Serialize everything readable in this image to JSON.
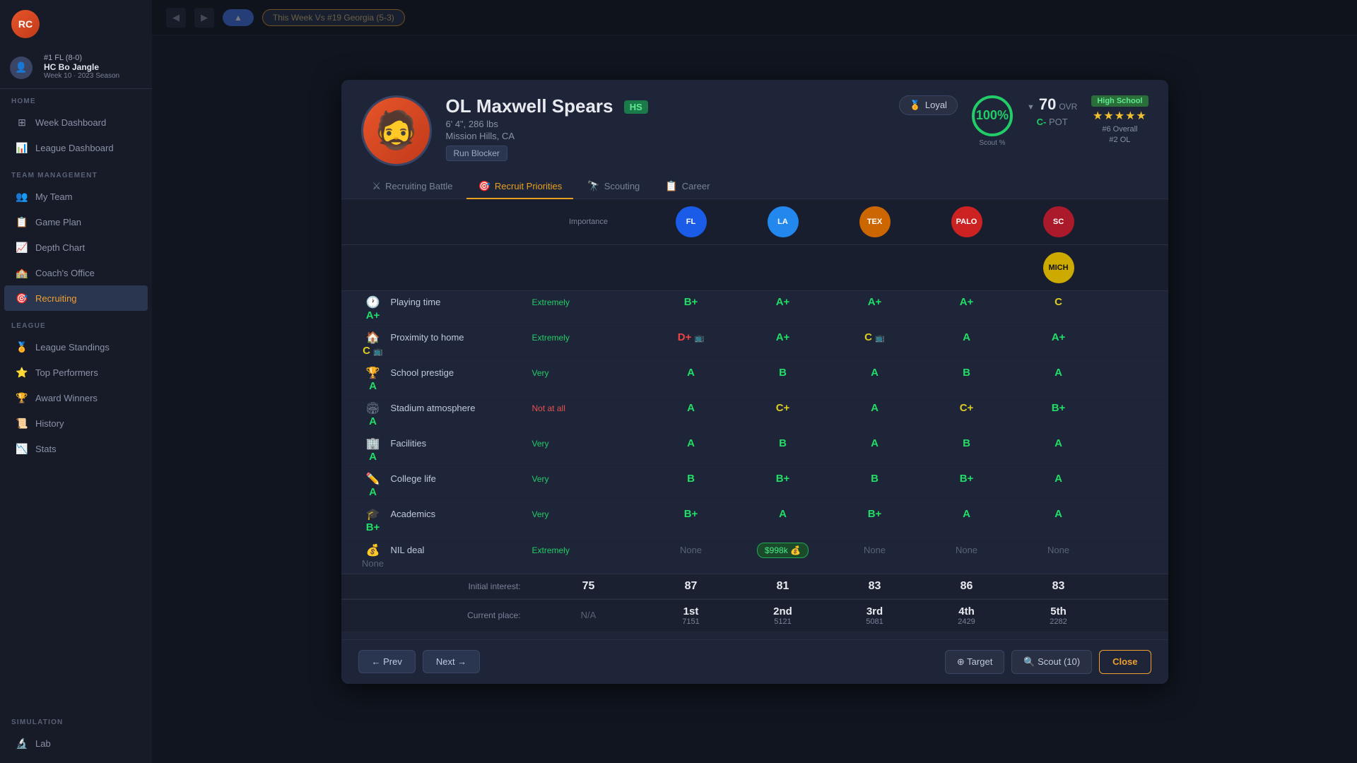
{
  "app": {
    "logo": "RC",
    "user": {
      "rank": "#1 FL (8-0)",
      "name": "HC Bo Jangle",
      "week": "Week 10",
      "season": "2023 Season"
    }
  },
  "topbar": {
    "week_btn": "▲",
    "game_label": "This Week Vs #19 Georgia (5-3)"
  },
  "sidebar": {
    "home_label": "HOME",
    "week_dashboard": "Week Dashboard",
    "league_dashboard": "League Dashboard",
    "team_label": "TEAM MANAGEMENT",
    "my_team": "My Team",
    "game_plan": "Game Plan",
    "depth_chart": "Depth Chart",
    "coaches_office": "Coach's Office",
    "league_label": "LEAGUE",
    "league_standings": "League Standings",
    "top_performers": "Top Performers",
    "award_winners": "Award Winners",
    "history": "History",
    "stats": "Stats",
    "simulation_label": "SIMULATION",
    "lab": "Lab",
    "recruiting": "Recruiting"
  },
  "modal": {
    "player": {
      "position": "OL",
      "name": "Maxwell Spears",
      "level": "HS",
      "height": "6' 4\"",
      "weight": "286 lbs",
      "hometown": "Mission Hills, CA",
      "role": "Run Blocker",
      "loyal": "Loyal",
      "scout_pct": "100%",
      "scout_label": "Scout %",
      "ovr": "70",
      "ovr_label": "OVR",
      "pot": "C-",
      "pot_label": "POT",
      "rank_title": "High School",
      "stars": "★★★★★",
      "rank_overall": "#6 Overall",
      "rank_pos": "#2 OL"
    },
    "tabs": [
      {
        "id": "recruiting-battle",
        "label": "Recruiting Battle",
        "icon": "⚔"
      },
      {
        "id": "recruit-priorities",
        "label": "Recruit Priorities",
        "icon": "🎯",
        "active": true
      },
      {
        "id": "scouting",
        "label": "Scouting",
        "icon": "🔭"
      },
      {
        "id": "career",
        "label": "Career",
        "icon": "📋"
      }
    ],
    "table": {
      "col_importance": "Importance",
      "schools": [
        {
          "abbr": "FL",
          "class": "badge-fl"
        },
        {
          "abbr": "LA",
          "class": "badge-la"
        },
        {
          "abbr": "TEX",
          "class": "badge-tex"
        },
        {
          "abbr": "PALO",
          "class": "badge-palo"
        },
        {
          "abbr": "SC",
          "class": "badge-sc"
        },
        {
          "abbr": "MICH",
          "class": "badge-mich"
        }
      ],
      "rows": [
        {
          "icon": "🕐",
          "category": "Playing time",
          "importance": "Extremely",
          "importance_class": "importance-extremely",
          "grades": [
            "B+",
            "A+",
            "A+",
            "A+",
            "C",
            "A+"
          ],
          "grade_classes": [
            "grade-green",
            "grade-green",
            "grade-green",
            "grade-green",
            "grade-yellow",
            "grade-green"
          ]
        },
        {
          "icon": "🏠",
          "category": "Proximity to home",
          "importance": "Extremely",
          "importance_class": "importance-extremely",
          "grades": [
            "D+",
            "A+",
            "C",
            "A",
            "A+",
            "C"
          ],
          "grade_classes": [
            "grade-red",
            "grade-green",
            "grade-yellow",
            "grade-green",
            "grade-green",
            "grade-yellow"
          ],
          "special": [
            {
              "index": 0,
              "icon": "📺"
            },
            {
              "index": 2,
              "icon": "📺"
            },
            {
              "index": 5,
              "icon": "📺"
            }
          ]
        },
        {
          "icon": "🏆",
          "category": "School prestige",
          "importance": "Very",
          "importance_class": "importance-very",
          "grades": [
            "A",
            "B",
            "A",
            "B",
            "A",
            "A"
          ],
          "grade_classes": [
            "grade-green",
            "grade-green",
            "grade-green",
            "grade-green",
            "grade-green",
            "grade-green"
          ]
        },
        {
          "icon": "🏟",
          "category": "Stadium atmosphere",
          "importance": "Not at all",
          "importance_class": "importance-not",
          "grades": [
            "A",
            "C+",
            "A",
            "C+",
            "B+",
            "A"
          ],
          "grade_classes": [
            "grade-green",
            "grade-yellow",
            "grade-green",
            "grade-yellow",
            "grade-green",
            "grade-green"
          ]
        },
        {
          "icon": "🏢",
          "category": "Facilities",
          "importance": "Very",
          "importance_class": "importance-very",
          "grades": [
            "A",
            "B",
            "A",
            "B",
            "A",
            "A"
          ],
          "grade_classes": [
            "grade-green",
            "grade-green",
            "grade-green",
            "grade-green",
            "grade-green",
            "grade-green"
          ]
        },
        {
          "icon": "✏️",
          "category": "College life",
          "importance": "Very",
          "importance_class": "importance-very",
          "grades": [
            "B",
            "B+",
            "B",
            "B+",
            "A",
            "A"
          ],
          "grade_classes": [
            "grade-green",
            "grade-green",
            "grade-green",
            "grade-green",
            "grade-green",
            "grade-green"
          ]
        },
        {
          "icon": "🎓",
          "category": "Academics",
          "importance": "Very",
          "importance_class": "importance-very",
          "grades": [
            "B+",
            "A",
            "B+",
            "A",
            "A",
            "B+"
          ],
          "grade_classes": [
            "grade-green",
            "grade-green",
            "grade-green",
            "grade-green",
            "grade-green",
            "grade-green"
          ]
        },
        {
          "icon": "💰",
          "category": "NIL deal",
          "importance": "Extremely",
          "importance_class": "importance-extremely",
          "grades": [
            "None",
            "$998k 💰",
            "None",
            "None",
            "None",
            "None"
          ],
          "grade_classes": [
            "grade-none",
            "nil",
            "grade-none",
            "grade-none",
            "grade-none",
            "grade-none"
          ]
        }
      ],
      "interest": {
        "label": "Initial interest:",
        "values": [
          "75",
          "87",
          "81",
          "83",
          "86",
          "83"
        ]
      },
      "place": {
        "label": "Current place:",
        "values": [
          {
            "place": "N/A",
            "score": ""
          },
          {
            "place": "1st",
            "score": "7151"
          },
          {
            "place": "2nd",
            "score": "5121"
          },
          {
            "place": "3rd",
            "score": "5081"
          },
          {
            "place": "4th",
            "score": "2429"
          },
          {
            "place": "5th",
            "score": "2282"
          }
        ]
      }
    },
    "footer": {
      "prev": "← Prev",
      "next": "Next →",
      "target": "⊕ Target",
      "scout": "🔍 Scout (10)",
      "close": "Close"
    }
  }
}
